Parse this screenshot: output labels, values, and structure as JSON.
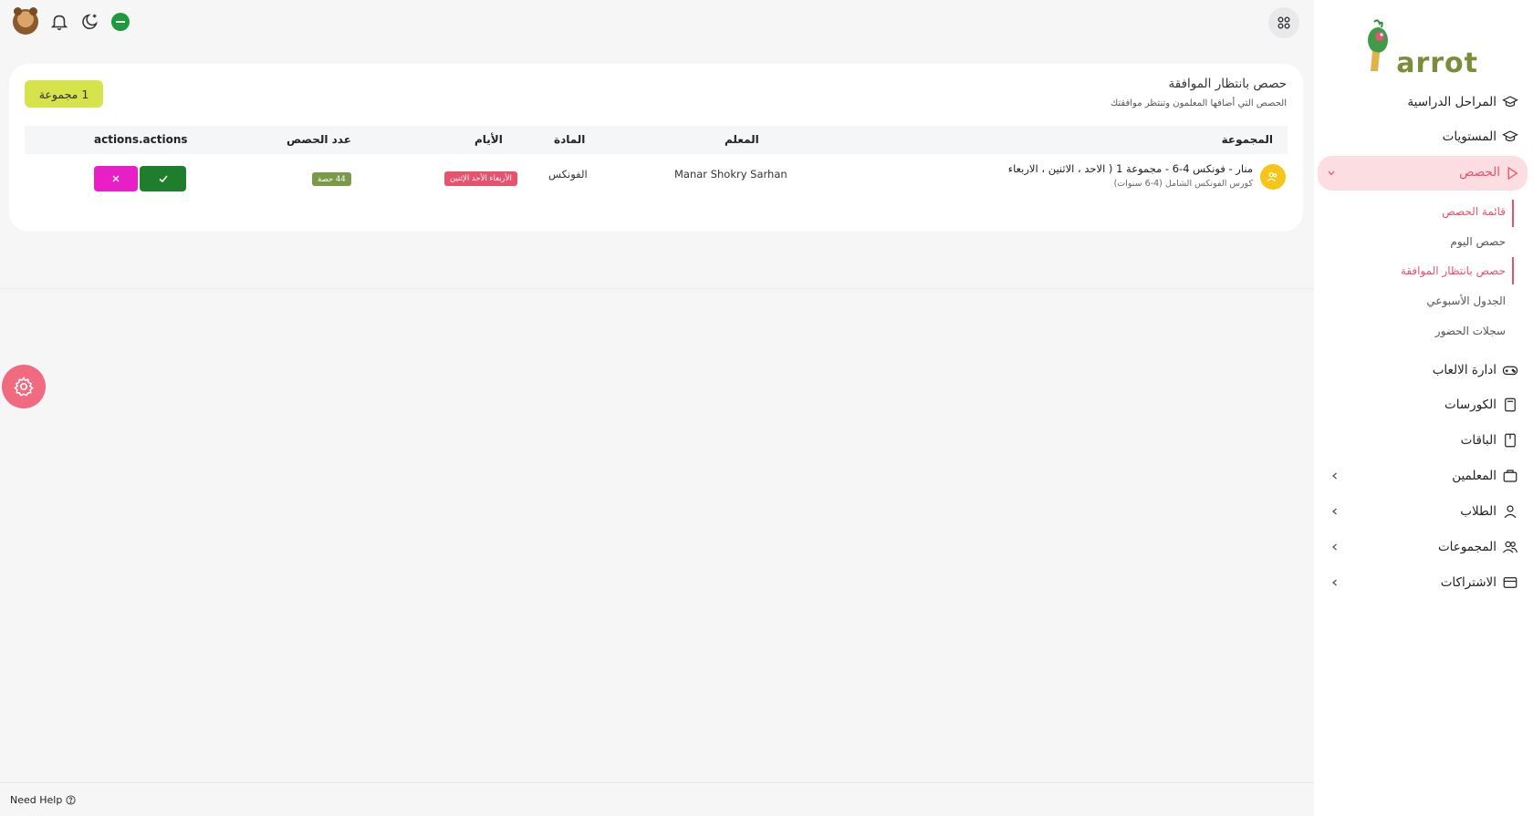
{
  "brand": {
    "logo_text": "arrot"
  },
  "header": {
    "icons": [
      "avatar",
      "bell-icon",
      "moon-icon",
      "saudi-flag-icon",
      "apps-icon"
    ]
  },
  "sidebar": {
    "items": [
      {
        "label": "المراحل الدراسية",
        "icon": "graduation-cap-icon"
      },
      {
        "label": "المستويات",
        "icon": "graduation-cap-icon"
      },
      {
        "label": "الحصص",
        "icon": "play-icon"
      },
      {
        "label": "ادارة الالعاب",
        "icon": "gamepad-icon"
      },
      {
        "label": "الكورسات",
        "icon": "book-icon"
      },
      {
        "label": "الباقات",
        "icon": "package-icon"
      },
      {
        "label": "المعلمين",
        "icon": "briefcase-icon"
      },
      {
        "label": "الطلاب",
        "icon": "user-icon"
      },
      {
        "label": "المجموعات",
        "icon": "users-icon"
      },
      {
        "label": "الاشتراكات",
        "icon": "card-icon"
      }
    ],
    "subitems": [
      {
        "label": "قائمة الحصص"
      },
      {
        "label": "حصص اليوم"
      },
      {
        "label": "حصص بانتظار الموافقة"
      },
      {
        "label": "الجدول الأسبوعي"
      },
      {
        "label": "سجلات الحضور"
      }
    ]
  },
  "main": {
    "title": "حصص بانتظار الموافقة",
    "subtitle": "الحصص التي أضافها المعلمون وتنتظر موافقتك",
    "group_count_badge": "1 مجموعة",
    "table": {
      "headers": {
        "group": "المجموعة",
        "teacher": "المعلم",
        "subject": "المادة",
        "days": "الأيام",
        "count": "عدد الحصص",
        "actions": "actions.actions"
      },
      "rows": [
        {
          "group_name": "منار - فونكس 4-6 - مجموعة 1 ( الاحد ، الاثنين ، الاربعاء",
          "course": "كورس الفونكس الشامل (4-6 سنوات)",
          "teacher": "Manar Shokry Sarhan",
          "subject": "الفونكس",
          "days": "الأربعاء الأحد الإثنين",
          "count": "44 حصة"
        }
      ]
    }
  },
  "footer": {
    "help": "Need Help"
  },
  "colors": {
    "accent": "#e7536e",
    "badge": "#d7e34a",
    "approve": "#1f7d2e",
    "reject": "#e81ec6",
    "count_badge": "#7a9a4a"
  }
}
